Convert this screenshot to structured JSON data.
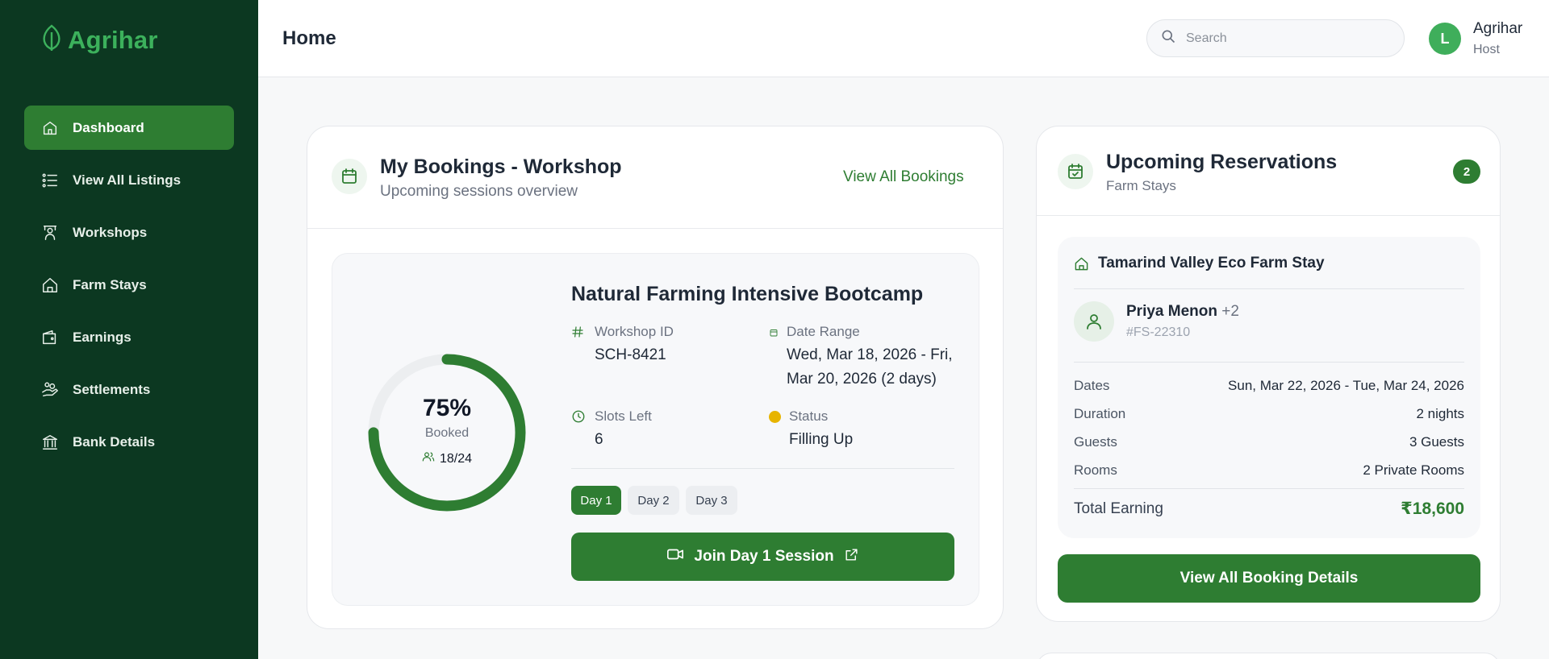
{
  "brand": {
    "name": "Agrihar"
  },
  "sidebar": {
    "items": [
      {
        "label": "Dashboard",
        "icon": "home-icon",
        "active": true
      },
      {
        "label": "View All Listings",
        "icon": "list-icon"
      },
      {
        "label": "Workshops",
        "icon": "presenter-icon"
      },
      {
        "label": "Farm Stays",
        "icon": "house-icon"
      },
      {
        "label": "Earnings",
        "icon": "wallet-icon"
      },
      {
        "label": "Settlements",
        "icon": "hand-coins-icon"
      },
      {
        "label": "Bank Details",
        "icon": "bank-icon"
      }
    ]
  },
  "header": {
    "title": "Home",
    "search_placeholder": "Search",
    "user": {
      "initial": "L",
      "name": "Agrihar",
      "role": "Host"
    }
  },
  "bookings": {
    "title": "My Bookings - Workshop",
    "subtitle": "Upcoming sessions overview",
    "view_all": "View All Bookings",
    "session": {
      "name": "Natural Farming Intensive Bootcamp",
      "booked_percent": 75,
      "booked_pct_text": "75%",
      "booked_label": "Booked",
      "booked_count": "18/24",
      "workshop_id_label": "Workshop ID",
      "workshop_id": "SCH-8421",
      "date_range_label": "Date Range",
      "date_range": "Wed, Mar 18, 2026 - Fri, Mar 20, 2026 (2 days)",
      "slots_left_label": "Slots Left",
      "slots_left": "6",
      "status_label": "Status",
      "status": "Filling Up",
      "days": [
        "Day 1",
        "Day 2",
        "Day 3"
      ],
      "join_label": "Join Day 1 Session"
    }
  },
  "reservations": {
    "title": "Upcoming Reservations",
    "subtitle": "Farm Stays",
    "count": "2",
    "stay": {
      "name": "Tamarind Valley Eco Farm Stay",
      "guest_name": "Priya Menon",
      "guest_extra": "+2",
      "booking_id": "#FS-22310",
      "rows": [
        {
          "label": "Dates",
          "value": "Sun, Mar 22, 2026 - Tue, Mar 24, 2026"
        },
        {
          "label": "Duration",
          "value": "2 nights"
        },
        {
          "label": "Guests",
          "value": "3 Guests"
        },
        {
          "label": "Rooms",
          "value": "2 Private Rooms"
        }
      ],
      "total_label": "Total Earning",
      "total_value": "₹18,600"
    },
    "details_button": "View All Booking Details"
  },
  "colors": {
    "sidebar": "#0c3821",
    "accent": "#2e7d32",
    "status_dot": "#e7b400"
  }
}
